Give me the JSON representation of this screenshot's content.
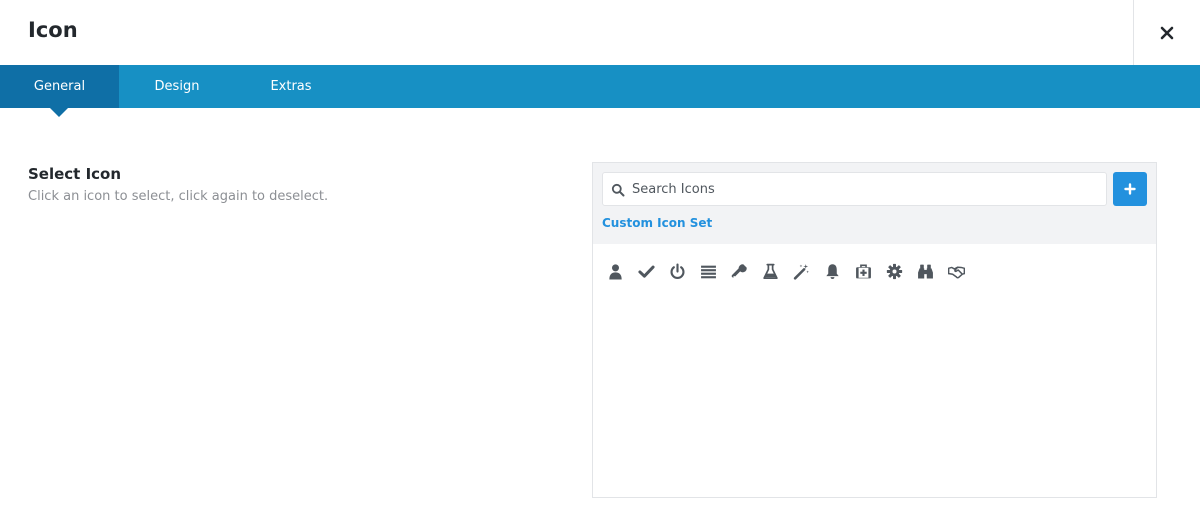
{
  "dialog": {
    "title": "Icon"
  },
  "tabs": [
    {
      "label": "General",
      "active": true
    },
    {
      "label": "Design",
      "active": false
    },
    {
      "label": "Extras",
      "active": false
    }
  ],
  "option": {
    "title": "Select Icon",
    "description": "Click an icon to select, click again to deselect."
  },
  "icon_picker": {
    "search_placeholder": "Search Icons",
    "custom_set_label": "Custom Icon Set",
    "icons": [
      "user-icon",
      "check-icon",
      "power-off-icon",
      "bars-icon",
      "wrench-icon",
      "flask-icon",
      "magic-wand-icon",
      "bell-icon",
      "medkit-icon",
      "cog-icon",
      "binoculars-icon",
      "handshake-icon"
    ]
  },
  "colors": {
    "tab_bar": "#1790c4",
    "tab_active": "#0f6fa6",
    "accent": "#2391de",
    "icon": "#50575e"
  }
}
